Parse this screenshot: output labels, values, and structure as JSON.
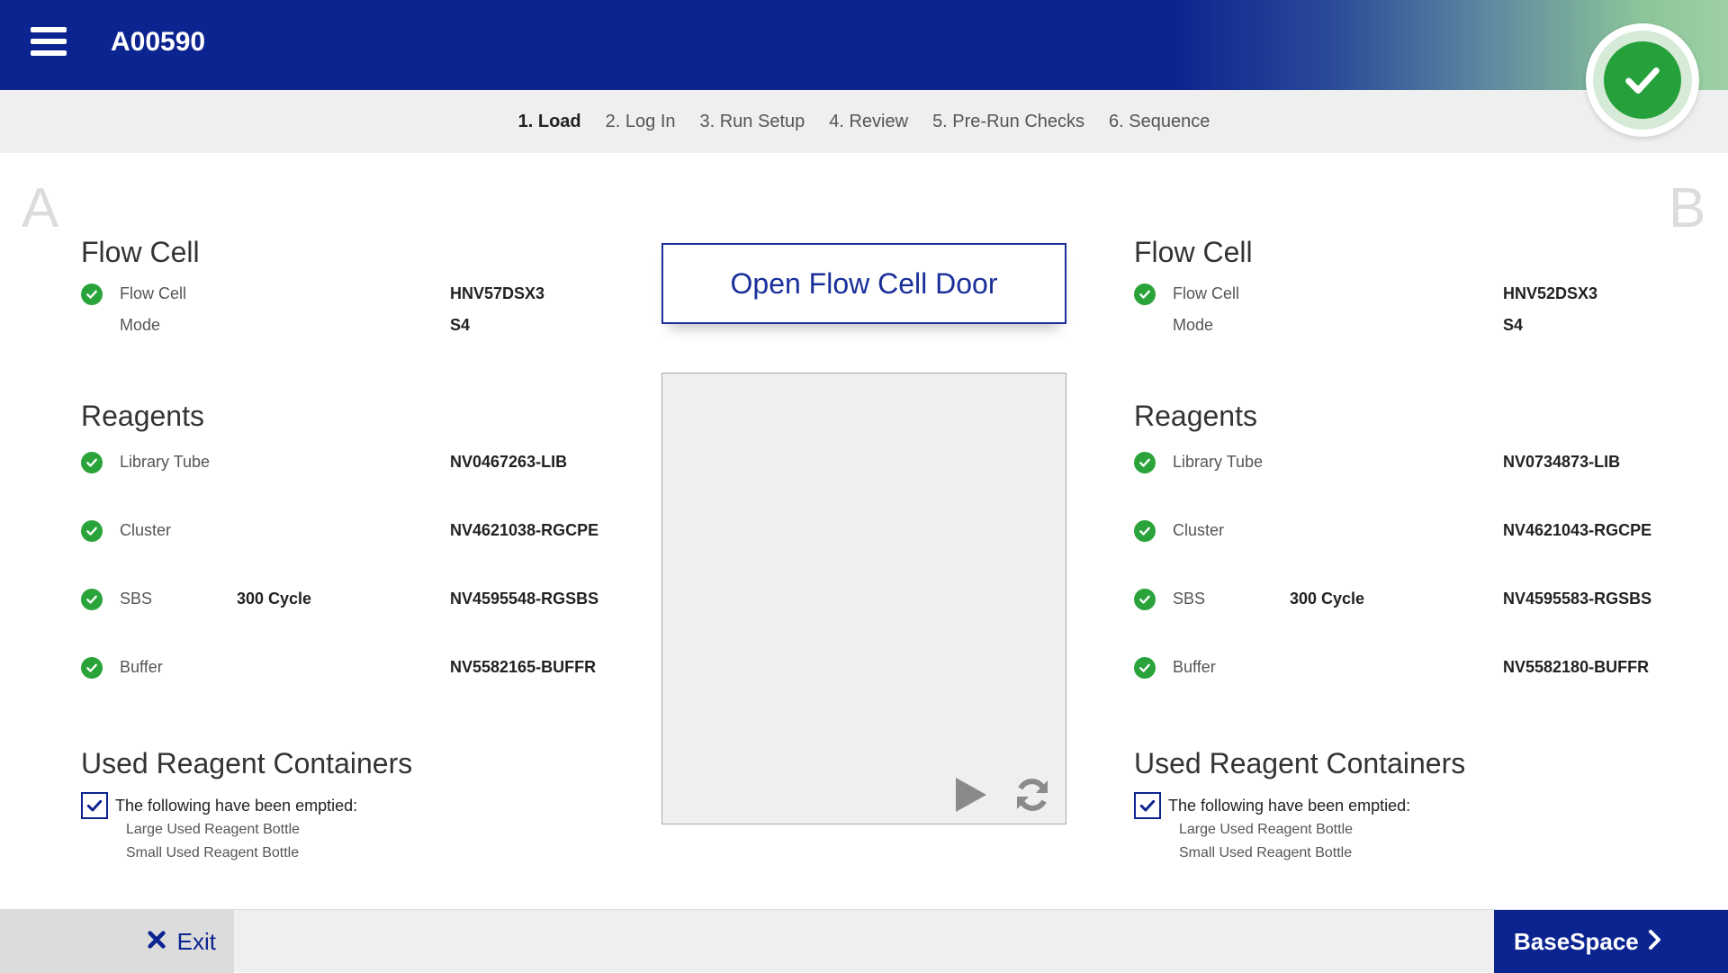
{
  "header": {
    "instrument_id": "A00590",
    "menu_icon": "hamburger-menu-icon",
    "status_icon": "check-icon",
    "colors": {
      "primary": "#0c2490",
      "success": "#26a03a"
    }
  },
  "steps": [
    {
      "label": "1. Load",
      "active": true
    },
    {
      "label": "2. Log In",
      "active": false
    },
    {
      "label": "3. Run Setup",
      "active": false
    },
    {
      "label": "4. Review",
      "active": false
    },
    {
      "label": "5. Pre-Run Checks",
      "active": false
    },
    {
      "label": "6. Sequence",
      "active": false
    }
  ],
  "side_a": {
    "letter": "A",
    "flow_cell": {
      "title": "Flow Cell",
      "flow_cell_label": "Flow Cell",
      "flow_cell_value": "HNV57DSX3",
      "mode_label": "Mode",
      "mode_value": "S4"
    },
    "reagents": {
      "title": "Reagents",
      "items": [
        {
          "label": "Library Tube",
          "detail": "",
          "value": "NV0467263-LIB"
        },
        {
          "label": "Cluster",
          "detail": "",
          "value": "NV4621038-RGCPE"
        },
        {
          "label": "SBS",
          "detail": "300 Cycle",
          "value": "NV4595548-RGSBS"
        },
        {
          "label": "Buffer",
          "detail": "",
          "value": "NV5582165-BUFFR"
        }
      ]
    },
    "used_containers": {
      "title": "Used Reagent Containers",
      "checked": true,
      "label": "The following have been emptied:",
      "items": [
        "Large Used Reagent Bottle",
        "Small Used Reagent Bottle"
      ]
    }
  },
  "side_b": {
    "letter": "B",
    "flow_cell": {
      "title": "Flow Cell",
      "flow_cell_label": "Flow Cell",
      "flow_cell_value": "HNV52DSX3",
      "mode_label": "Mode",
      "mode_value": "S4"
    },
    "reagents": {
      "title": "Reagents",
      "items": [
        {
          "label": "Library Tube",
          "detail": "",
          "value": "NV0734873-LIB"
        },
        {
          "label": "Cluster",
          "detail": "",
          "value": "NV4621043-RGCPE"
        },
        {
          "label": "SBS",
          "detail": "300 Cycle",
          "value": "NV4595583-RGSBS"
        },
        {
          "label": "Buffer",
          "detail": "",
          "value": "NV5582180-BUFFR"
        }
      ]
    },
    "used_containers": {
      "title": "Used Reagent Containers",
      "checked": true,
      "label": "The following have been emptied:",
      "items": [
        "Large Used Reagent Bottle",
        "Small Used Reagent Bottle"
      ]
    }
  },
  "center": {
    "open_door_label": "Open Flow Cell Door",
    "video_icons": [
      "play-icon",
      "refresh-icon"
    ]
  },
  "footer": {
    "exit_label": "Exit",
    "exit_icon": "close-icon",
    "next_label": "BaseSpace",
    "next_icon": "chevron-right-icon"
  }
}
